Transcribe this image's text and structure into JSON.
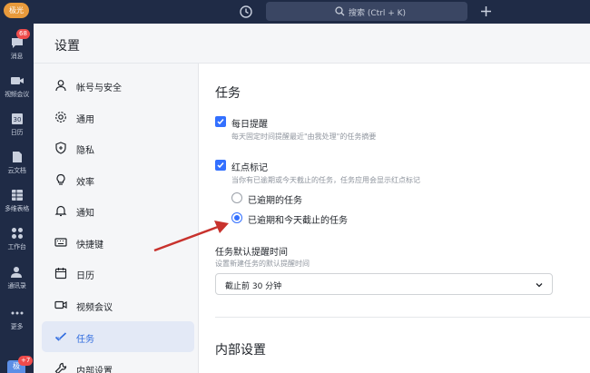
{
  "rail": {
    "avatar": "极光",
    "items": [
      {
        "label": "消息",
        "badge": "68"
      },
      {
        "label": "视频会议"
      },
      {
        "label": "日历",
        "cal": "30"
      },
      {
        "label": "云文档"
      },
      {
        "label": "多维表格"
      },
      {
        "label": "工作台"
      },
      {
        "label": "通讯录"
      },
      {
        "label": "更多"
      }
    ],
    "bottom_avatar": "极",
    "bottom_badge": "+7"
  },
  "topbar": {
    "search_placeholder": "搜索 (Ctrl + K)"
  },
  "header": {
    "title": "设置"
  },
  "nav": {
    "items": [
      {
        "label": "帐号与安全"
      },
      {
        "label": "通用"
      },
      {
        "label": "隐私"
      },
      {
        "label": "效率"
      },
      {
        "label": "通知"
      },
      {
        "label": "快捷键"
      },
      {
        "label": "日历"
      },
      {
        "label": "视频会议"
      },
      {
        "label": "任务",
        "active": true
      },
      {
        "label": "内部设置"
      }
    ]
  },
  "main": {
    "section_title": "任务",
    "daily_reminder": {
      "title": "每日提醒",
      "desc": "每天固定时间提醒最近\"由我处理\"的任务摘要",
      "checked": true
    },
    "red_dot": {
      "title": "红点标记",
      "desc": "当你有已逾期或今天截止的任务，任务应用会显示红点标记",
      "checked": true,
      "options": [
        {
          "label": "已逾期的任务",
          "selected": false
        },
        {
          "label": "已逾期和今天截止的任务",
          "selected": true
        }
      ]
    },
    "default_reminder": {
      "title": "任务默认提醒时间",
      "desc": "设置新建任务的默认提醒时间",
      "value": "截止前 30 分钟"
    },
    "internal_title": "内部设置"
  },
  "colors": {
    "accent": "#3370ff",
    "rail_bg": "#1f2b46",
    "annotation_arrow": "#c8322d"
  }
}
